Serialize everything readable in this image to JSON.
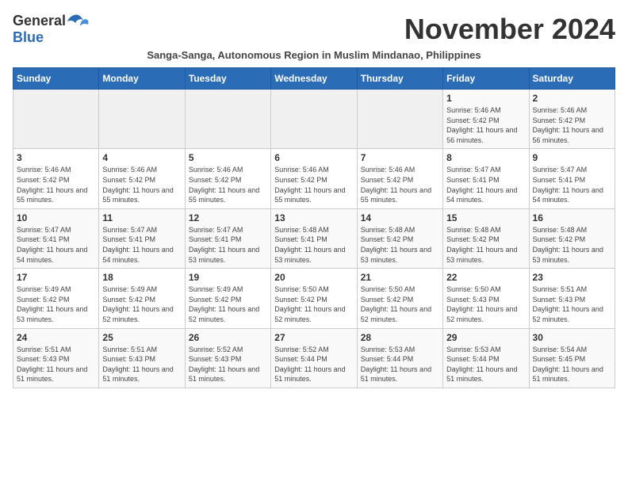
{
  "header": {
    "logo_general": "General",
    "logo_blue": "Blue",
    "month_title": "November 2024",
    "subtitle": "Sanga-Sanga, Autonomous Region in Muslim Mindanao, Philippines"
  },
  "days_of_week": [
    "Sunday",
    "Monday",
    "Tuesday",
    "Wednesday",
    "Thursday",
    "Friday",
    "Saturday"
  ],
  "weeks": [
    [
      {
        "day": "",
        "info": ""
      },
      {
        "day": "",
        "info": ""
      },
      {
        "day": "",
        "info": ""
      },
      {
        "day": "",
        "info": ""
      },
      {
        "day": "",
        "info": ""
      },
      {
        "day": "1",
        "info": "Sunrise: 5:46 AM\nSunset: 5:42 PM\nDaylight: 11 hours and 56 minutes."
      },
      {
        "day": "2",
        "info": "Sunrise: 5:46 AM\nSunset: 5:42 PM\nDaylight: 11 hours and 56 minutes."
      }
    ],
    [
      {
        "day": "3",
        "info": "Sunrise: 5:46 AM\nSunset: 5:42 PM\nDaylight: 11 hours and 55 minutes."
      },
      {
        "day": "4",
        "info": "Sunrise: 5:46 AM\nSunset: 5:42 PM\nDaylight: 11 hours and 55 minutes."
      },
      {
        "day": "5",
        "info": "Sunrise: 5:46 AM\nSunset: 5:42 PM\nDaylight: 11 hours and 55 minutes."
      },
      {
        "day": "6",
        "info": "Sunrise: 5:46 AM\nSunset: 5:42 PM\nDaylight: 11 hours and 55 minutes."
      },
      {
        "day": "7",
        "info": "Sunrise: 5:46 AM\nSunset: 5:42 PM\nDaylight: 11 hours and 55 minutes."
      },
      {
        "day": "8",
        "info": "Sunrise: 5:47 AM\nSunset: 5:41 PM\nDaylight: 11 hours and 54 minutes."
      },
      {
        "day": "9",
        "info": "Sunrise: 5:47 AM\nSunset: 5:41 PM\nDaylight: 11 hours and 54 minutes."
      }
    ],
    [
      {
        "day": "10",
        "info": "Sunrise: 5:47 AM\nSunset: 5:41 PM\nDaylight: 11 hours and 54 minutes."
      },
      {
        "day": "11",
        "info": "Sunrise: 5:47 AM\nSunset: 5:41 PM\nDaylight: 11 hours and 54 minutes."
      },
      {
        "day": "12",
        "info": "Sunrise: 5:47 AM\nSunset: 5:41 PM\nDaylight: 11 hours and 53 minutes."
      },
      {
        "day": "13",
        "info": "Sunrise: 5:48 AM\nSunset: 5:41 PM\nDaylight: 11 hours and 53 minutes."
      },
      {
        "day": "14",
        "info": "Sunrise: 5:48 AM\nSunset: 5:42 PM\nDaylight: 11 hours and 53 minutes."
      },
      {
        "day": "15",
        "info": "Sunrise: 5:48 AM\nSunset: 5:42 PM\nDaylight: 11 hours and 53 minutes."
      },
      {
        "day": "16",
        "info": "Sunrise: 5:48 AM\nSunset: 5:42 PM\nDaylight: 11 hours and 53 minutes."
      }
    ],
    [
      {
        "day": "17",
        "info": "Sunrise: 5:49 AM\nSunset: 5:42 PM\nDaylight: 11 hours and 53 minutes."
      },
      {
        "day": "18",
        "info": "Sunrise: 5:49 AM\nSunset: 5:42 PM\nDaylight: 11 hours and 52 minutes."
      },
      {
        "day": "19",
        "info": "Sunrise: 5:49 AM\nSunset: 5:42 PM\nDaylight: 11 hours and 52 minutes."
      },
      {
        "day": "20",
        "info": "Sunrise: 5:50 AM\nSunset: 5:42 PM\nDaylight: 11 hours and 52 minutes."
      },
      {
        "day": "21",
        "info": "Sunrise: 5:50 AM\nSunset: 5:42 PM\nDaylight: 11 hours and 52 minutes."
      },
      {
        "day": "22",
        "info": "Sunrise: 5:50 AM\nSunset: 5:43 PM\nDaylight: 11 hours and 52 minutes."
      },
      {
        "day": "23",
        "info": "Sunrise: 5:51 AM\nSunset: 5:43 PM\nDaylight: 11 hours and 52 minutes."
      }
    ],
    [
      {
        "day": "24",
        "info": "Sunrise: 5:51 AM\nSunset: 5:43 PM\nDaylight: 11 hours and 51 minutes."
      },
      {
        "day": "25",
        "info": "Sunrise: 5:51 AM\nSunset: 5:43 PM\nDaylight: 11 hours and 51 minutes."
      },
      {
        "day": "26",
        "info": "Sunrise: 5:52 AM\nSunset: 5:43 PM\nDaylight: 11 hours and 51 minutes."
      },
      {
        "day": "27",
        "info": "Sunrise: 5:52 AM\nSunset: 5:44 PM\nDaylight: 11 hours and 51 minutes."
      },
      {
        "day": "28",
        "info": "Sunrise: 5:53 AM\nSunset: 5:44 PM\nDaylight: 11 hours and 51 minutes."
      },
      {
        "day": "29",
        "info": "Sunrise: 5:53 AM\nSunset: 5:44 PM\nDaylight: 11 hours and 51 minutes."
      },
      {
        "day": "30",
        "info": "Sunrise: 5:54 AM\nSunset: 5:45 PM\nDaylight: 11 hours and 51 minutes."
      }
    ]
  ]
}
